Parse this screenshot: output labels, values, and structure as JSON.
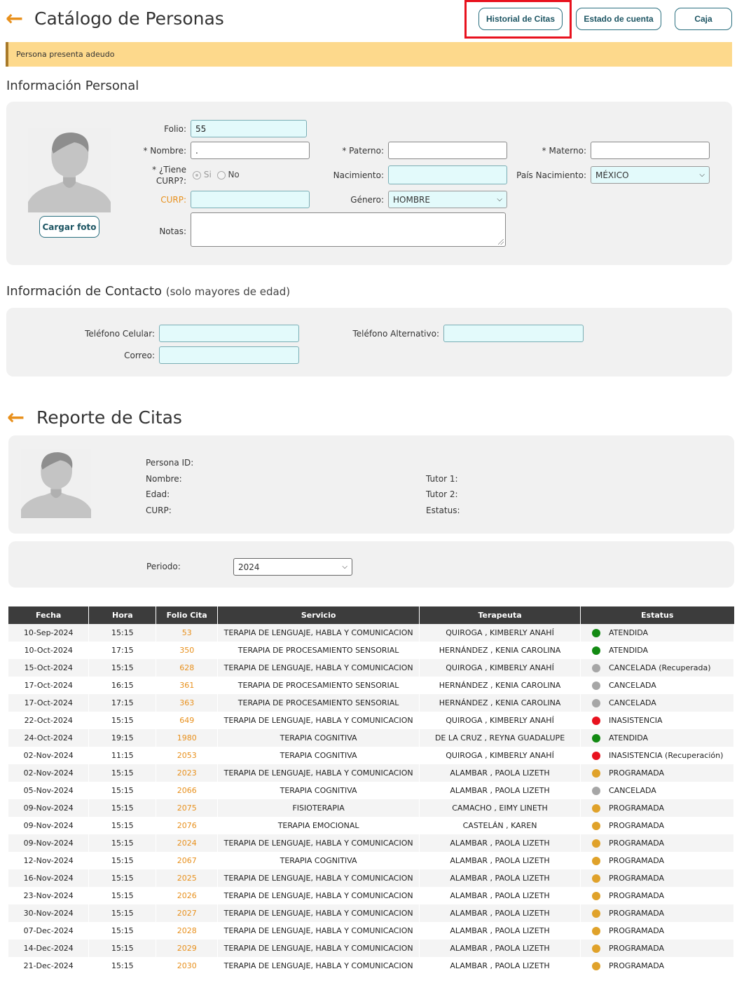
{
  "header": {
    "title": "Catálogo de Personas",
    "buttons": {
      "historial": "Historial de Citas",
      "estado": "Estado de cuenta",
      "caja": "Caja"
    }
  },
  "alert": "Persona presenta adeudo",
  "personal": {
    "title": "Información Personal",
    "upload_label": "Cargar foto",
    "folio_label": "Folio:",
    "folio_value": "55",
    "nombre_label": "* Nombre:",
    "nombre_value": ".",
    "paterno_label": "* Paterno:",
    "paterno_value": "",
    "materno_label": "* Materno:",
    "materno_value": "",
    "tiene_curp_label_1": "* ¿Tiene",
    "tiene_curp_label_2": "CURP?:",
    "si_label": "Si",
    "no_label": "No",
    "nacimiento_label": "Nacimiento:",
    "nacimiento_value": "",
    "pais_label": "País Nacimiento:",
    "pais_value": "MÉXICO",
    "curp_label": "CURP:",
    "curp_value": "",
    "genero_label": "Género:",
    "genero_value": "HOMBRE",
    "notas_label": "Notas:",
    "notas_value": ""
  },
  "contacto": {
    "title": "Información de Contacto",
    "subtitle": "(solo mayores de edad)",
    "celular_label": "Teléfono Celular:",
    "celular_value": "",
    "alternativo_label": "Teléfono Alternativo:",
    "alternativo_value": "",
    "correo_label": "Correo:",
    "correo_value": ""
  },
  "reporte": {
    "title": "Reporte de Citas",
    "persona_id_label": "Persona ID:",
    "nombre_label": "Nombre:",
    "edad_label": "Edad:",
    "curp_label": "CURP:",
    "tutor1_label": "Tutor 1:",
    "tutor2_label": "Tutor 2:",
    "estatus_label": "Estatus:",
    "periodo_label": "Periodo:",
    "periodo_value": "2024"
  },
  "colors": {
    "accent": "#e8901c",
    "green": "#138a13",
    "gray": "#a6a6a6",
    "red": "#e8121e",
    "yellow": "#e0a22a"
  },
  "table": {
    "headers": [
      "Fecha",
      "Hora",
      "Folio Cita",
      "Servicio",
      "Terapeuta",
      "Estatus"
    ],
    "rows": [
      {
        "fecha": "10-Sep-2024",
        "hora": "15:15",
        "folio": "53",
        "servicio": "TERAPIA DE LENGUAJE, HABLA Y COMUNICACION",
        "terapeuta": "QUIROGA , KIMBERLY ANAHÍ",
        "estatus": "ATENDIDA",
        "color": "#138a13"
      },
      {
        "fecha": "10-Oct-2024",
        "hora": "17:15",
        "folio": "350",
        "servicio": "TERAPIA DE PROCESAMIENTO SENSORIAL",
        "terapeuta": "HERNÁNDEZ , KENIA CAROLINA",
        "estatus": "ATENDIDA",
        "color": "#138a13"
      },
      {
        "fecha": "15-Oct-2024",
        "hora": "15:15",
        "folio": "628",
        "servicio": "TERAPIA DE LENGUAJE, HABLA Y COMUNICACION",
        "terapeuta": "QUIROGA , KIMBERLY ANAHÍ",
        "estatus": "CANCELADA (Recuperada)",
        "color": "#a6a6a6"
      },
      {
        "fecha": "17-Oct-2024",
        "hora": "16:15",
        "folio": "361",
        "servicio": "TERAPIA DE PROCESAMIENTO SENSORIAL",
        "terapeuta": "HERNÁNDEZ , KENIA CAROLINA",
        "estatus": "CANCELADA",
        "color": "#a6a6a6"
      },
      {
        "fecha": "17-Oct-2024",
        "hora": "17:15",
        "folio": "363",
        "servicio": "TERAPIA DE PROCESAMIENTO SENSORIAL",
        "terapeuta": "HERNÁNDEZ , KENIA CAROLINA",
        "estatus": "CANCELADA",
        "color": "#a6a6a6"
      },
      {
        "fecha": "22-Oct-2024",
        "hora": "15:15",
        "folio": "649",
        "servicio": "TERAPIA DE LENGUAJE, HABLA Y COMUNICACION",
        "terapeuta": "QUIROGA , KIMBERLY ANAHÍ",
        "estatus": "INASISTENCIA",
        "color": "#e8121e"
      },
      {
        "fecha": "24-Oct-2024",
        "hora": "19:15",
        "folio": "1980",
        "servicio": "TERAPIA COGNITIVA",
        "terapeuta": "DE LA CRUZ , REYNA GUADALUPE",
        "estatus": "ATENDIDA",
        "color": "#138a13"
      },
      {
        "fecha": "02-Nov-2024",
        "hora": "11:15",
        "folio": "2053",
        "servicio": "TERAPIA COGNITIVA",
        "terapeuta": "QUIROGA , KIMBERLY ANAHÍ",
        "estatus": "INASISTENCIA (Recuperación)",
        "color": "#e8121e"
      },
      {
        "fecha": "02-Nov-2024",
        "hora": "15:15",
        "folio": "2023",
        "servicio": "TERAPIA DE LENGUAJE, HABLA Y COMUNICACION",
        "terapeuta": "ALAMBAR , PAOLA LIZETH",
        "estatus": "PROGRAMADA",
        "color": "#e0a22a"
      },
      {
        "fecha": "05-Nov-2024",
        "hora": "15:15",
        "folio": "2066",
        "servicio": "TERAPIA COGNITIVA",
        "terapeuta": "ALAMBAR , PAOLA LIZETH",
        "estatus": "CANCELADA",
        "color": "#a6a6a6"
      },
      {
        "fecha": "09-Nov-2024",
        "hora": "15:15",
        "folio": "2075",
        "servicio": "FISIOTERAPIA",
        "terapeuta": "CAMACHO , EIMY LINETH",
        "estatus": "PROGRAMADA",
        "color": "#e0a22a"
      },
      {
        "fecha": "09-Nov-2024",
        "hora": "15:15",
        "folio": "2076",
        "servicio": "TERAPIA EMOCIONAL",
        "terapeuta": "CASTELÁN , KAREN",
        "estatus": "PROGRAMADA",
        "color": "#e0a22a"
      },
      {
        "fecha": "09-Nov-2024",
        "hora": "15:15",
        "folio": "2024",
        "servicio": "TERAPIA DE LENGUAJE, HABLA Y COMUNICACION",
        "terapeuta": "ALAMBAR , PAOLA LIZETH",
        "estatus": "PROGRAMADA",
        "color": "#e0a22a"
      },
      {
        "fecha": "12-Nov-2024",
        "hora": "15:15",
        "folio": "2067",
        "servicio": "TERAPIA COGNITIVA",
        "terapeuta": "ALAMBAR , PAOLA LIZETH",
        "estatus": "PROGRAMADA",
        "color": "#e0a22a"
      },
      {
        "fecha": "16-Nov-2024",
        "hora": "15:15",
        "folio": "2025",
        "servicio": "TERAPIA DE LENGUAJE, HABLA Y COMUNICACION",
        "terapeuta": "ALAMBAR , PAOLA LIZETH",
        "estatus": "PROGRAMADA",
        "color": "#e0a22a"
      },
      {
        "fecha": "23-Nov-2024",
        "hora": "15:15",
        "folio": "2026",
        "servicio": "TERAPIA DE LENGUAJE, HABLA Y COMUNICACION",
        "terapeuta": "ALAMBAR , PAOLA LIZETH",
        "estatus": "PROGRAMADA",
        "color": "#e0a22a"
      },
      {
        "fecha": "30-Nov-2024",
        "hora": "15:15",
        "folio": "2027",
        "servicio": "TERAPIA DE LENGUAJE, HABLA Y COMUNICACION",
        "terapeuta": "ALAMBAR , PAOLA LIZETH",
        "estatus": "PROGRAMADA",
        "color": "#e0a22a"
      },
      {
        "fecha": "07-Dec-2024",
        "hora": "15:15",
        "folio": "2028",
        "servicio": "TERAPIA DE LENGUAJE, HABLA Y COMUNICACION",
        "terapeuta": "ALAMBAR , PAOLA LIZETH",
        "estatus": "PROGRAMADA",
        "color": "#e0a22a"
      },
      {
        "fecha": "14-Dec-2024",
        "hora": "15:15",
        "folio": "2029",
        "servicio": "TERAPIA DE LENGUAJE, HABLA Y COMUNICACION",
        "terapeuta": "ALAMBAR , PAOLA LIZETH",
        "estatus": "PROGRAMADA",
        "color": "#e0a22a"
      },
      {
        "fecha": "21-Dec-2024",
        "hora": "15:15",
        "folio": "2030",
        "servicio": "TERAPIA DE LENGUAJE, HABLA Y COMUNICACION",
        "terapeuta": "ALAMBAR , PAOLA LIZETH",
        "estatus": "PROGRAMADA",
        "color": "#e0a22a"
      }
    ]
  }
}
